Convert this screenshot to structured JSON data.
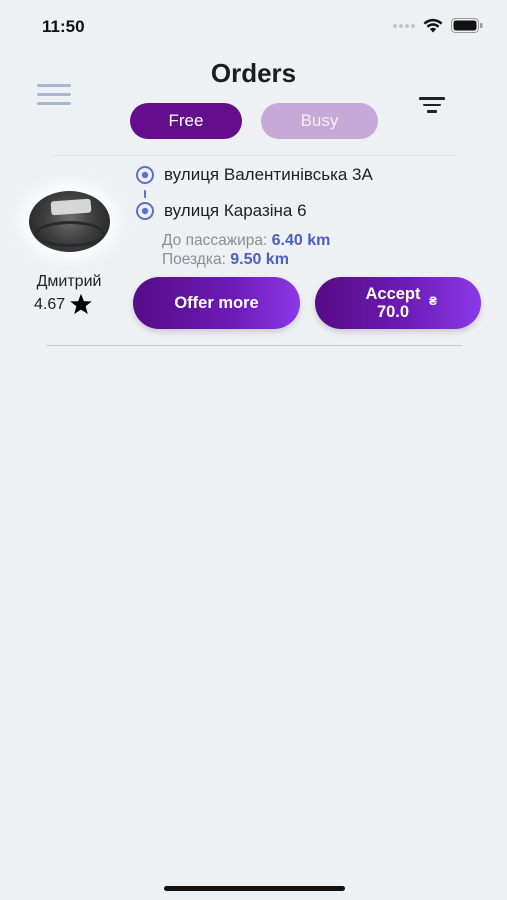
{
  "status_bar": {
    "time": "11:50"
  },
  "header": {
    "title": "Orders"
  },
  "segments": {
    "free_label": "Free",
    "busy_label": "Busy",
    "selected": "Free"
  },
  "order": {
    "driver": {
      "name": "Дмитрий",
      "rating": "4.67"
    },
    "route": {
      "from": "вулиця Валентинівська 3А",
      "to": "вулиця Каразіна 6"
    },
    "to_passenger_label": "До пассажира:",
    "to_passenger_value": "6.40 km",
    "trip_label": "Поездка:",
    "trip_value": "9.50 km",
    "offer_more_label": "Offer more",
    "accept_label": "Accept",
    "accept_price": "70.0",
    "currency_symbol": "₴"
  },
  "colors": {
    "background": "#edf1f3",
    "accent": "#640e8e",
    "segment_inactive": "#c7a9d8",
    "route_icon": "#5a6fd1",
    "distance_value": "#4b5fc8"
  }
}
